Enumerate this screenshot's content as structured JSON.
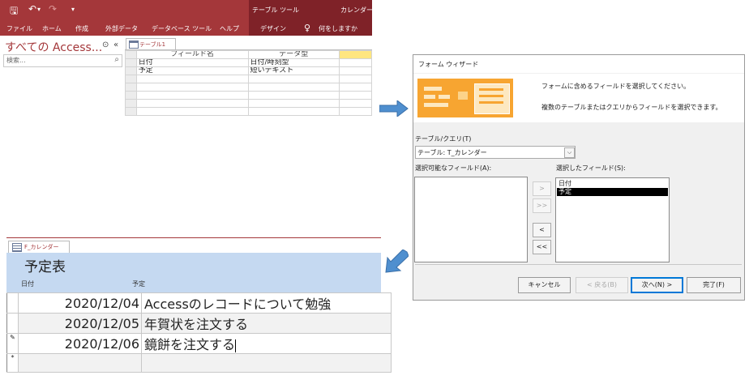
{
  "ribbon": {
    "tool_group": "テーブル ツール",
    "doc_title": "カレンダー",
    "tabs": [
      "ファイル",
      "ホーム",
      "作成",
      "外部データ",
      "データベース ツール",
      "ヘルプ",
      "デザイン"
    ],
    "tell_me": "何をしますか"
  },
  "nav": {
    "title": "すべての Access...",
    "search_placeholder": "検索..."
  },
  "design": {
    "tab_label": "テーブル1",
    "col_field": "フィールド名",
    "col_type": "データ型",
    "rows": [
      {
        "field": "日付",
        "type": "日付/時刻型"
      },
      {
        "field": "予定",
        "type": "短いテキスト"
      }
    ]
  },
  "wizard": {
    "title": "フォーム ウィザード",
    "msg1": "フォームに含めるフィールドを選択してください。",
    "msg2": "複数のテーブルまたはクエリからフィールドを選択できます。",
    "table_query_label": "テーブル/クエリ(T)",
    "table_query_value": "テーブル: T_カレンダー",
    "available_label": "選択可能なフィールド(A):",
    "selected_label": "選択したフィールド(S):",
    "selected_fields": [
      "日付",
      "予定"
    ],
    "move_buttons": [
      ">",
      ">>",
      "<",
      "<<"
    ],
    "buttons": {
      "cancel": "キャンセル",
      "back": "< 戻る(B)",
      "next": "次へ(N) >",
      "finish": "完了(F)"
    }
  },
  "form": {
    "tab_label": "F_カレンダー",
    "heading": "予定表",
    "col_date": "日付",
    "col_plan": "予定",
    "records": [
      {
        "date": "2020/12/04",
        "plan": "Accessのレコードについて勉強"
      },
      {
        "date": "2020/12/05",
        "plan": "年賀状を注文する"
      },
      {
        "date": "2020/12/06",
        "plan": "鏡餅を注文する"
      }
    ],
    "new_row_marker": "*",
    "edit_marker": "✎"
  },
  "colors": {
    "access_brand": "#a4373a",
    "form_header": "#c5d9f1",
    "arrow": "#4f8fcf"
  }
}
